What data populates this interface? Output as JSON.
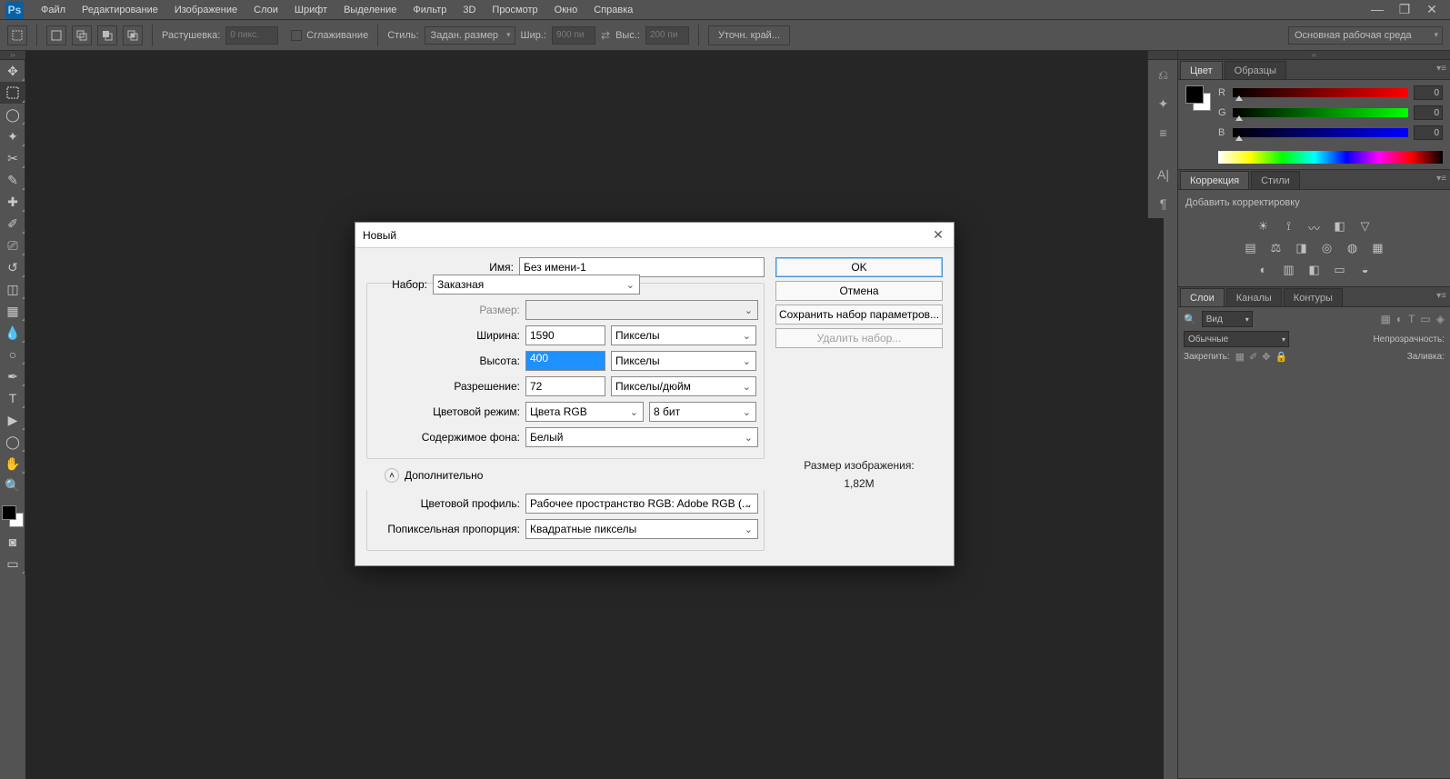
{
  "menubar": {
    "logo": "Ps",
    "items": [
      "Файл",
      "Редактирование",
      "Изображение",
      "Слои",
      "Шрифт",
      "Выделение",
      "Фильтр",
      "3D",
      "Просмотр",
      "Окно",
      "Справка"
    ]
  },
  "optionsbar": {
    "feather_label": "Растушевка:",
    "feather_value": "0 пикс.",
    "antialias_label": "Сглаживание",
    "style_label": "Стиль:",
    "style_value": "Задан. размер",
    "width_label": "Шир.:",
    "width_value": "900 пи",
    "height_label": "Выс.:",
    "height_value": "200 пи",
    "refine_label": "Уточн. край...",
    "workspace": "Основная рабочая среда"
  },
  "dialog": {
    "title": "Новый",
    "name_label": "Имя:",
    "name_value": "Без имени-1",
    "preset_label": "Набор:",
    "preset_value": "Заказная",
    "size_label": "Размер:",
    "width_label": "Ширина:",
    "width_value": "1590",
    "width_unit": "Пикселы",
    "height_label": "Высота:",
    "height_value": "400",
    "height_unit": "Пикселы",
    "resolution_label": "Разрешение:",
    "resolution_value": "72",
    "resolution_unit": "Пикселы/дюйм",
    "colormode_label": "Цветовой режим:",
    "colormode_value": "Цвета RGB",
    "bitdepth_value": "8 бит",
    "bgcontents_label": "Содержимое фона:",
    "bgcontents_value": "Белый",
    "advanced_label": "Дополнительно",
    "profile_label": "Цветовой профиль:",
    "profile_value": "Рабочее пространство RGB:  Adobe RGB (...",
    "pixelaspect_label": "Попиксельная пропорция:",
    "pixelaspect_value": "Квадратные пикселы",
    "ok_label": "OK",
    "cancel_label": "Отмена",
    "savepreset_label": "Сохранить набор параметров...",
    "deletepreset_label": "Удалить набор...",
    "imagesize_label": "Размер изображения:",
    "imagesize_value": "1,82M"
  },
  "color_panel": {
    "tabs": [
      "Цвет",
      "Образцы"
    ],
    "channels": [
      {
        "label": "R",
        "value": "0"
      },
      {
        "label": "G",
        "value": "0"
      },
      {
        "label": "B",
        "value": "0"
      }
    ]
  },
  "adjustments_panel": {
    "tabs": [
      "Коррекция",
      "Стили"
    ],
    "add_label": "Добавить корректировку"
  },
  "layers_panel": {
    "tabs": [
      "Слои",
      "Каналы",
      "Контуры"
    ],
    "kind_label": "Вид",
    "blendmode": "Обычные",
    "opacity_label": "Непрозрачность:",
    "lock_label": "Закрепить:",
    "fill_label": "Заливка:"
  }
}
